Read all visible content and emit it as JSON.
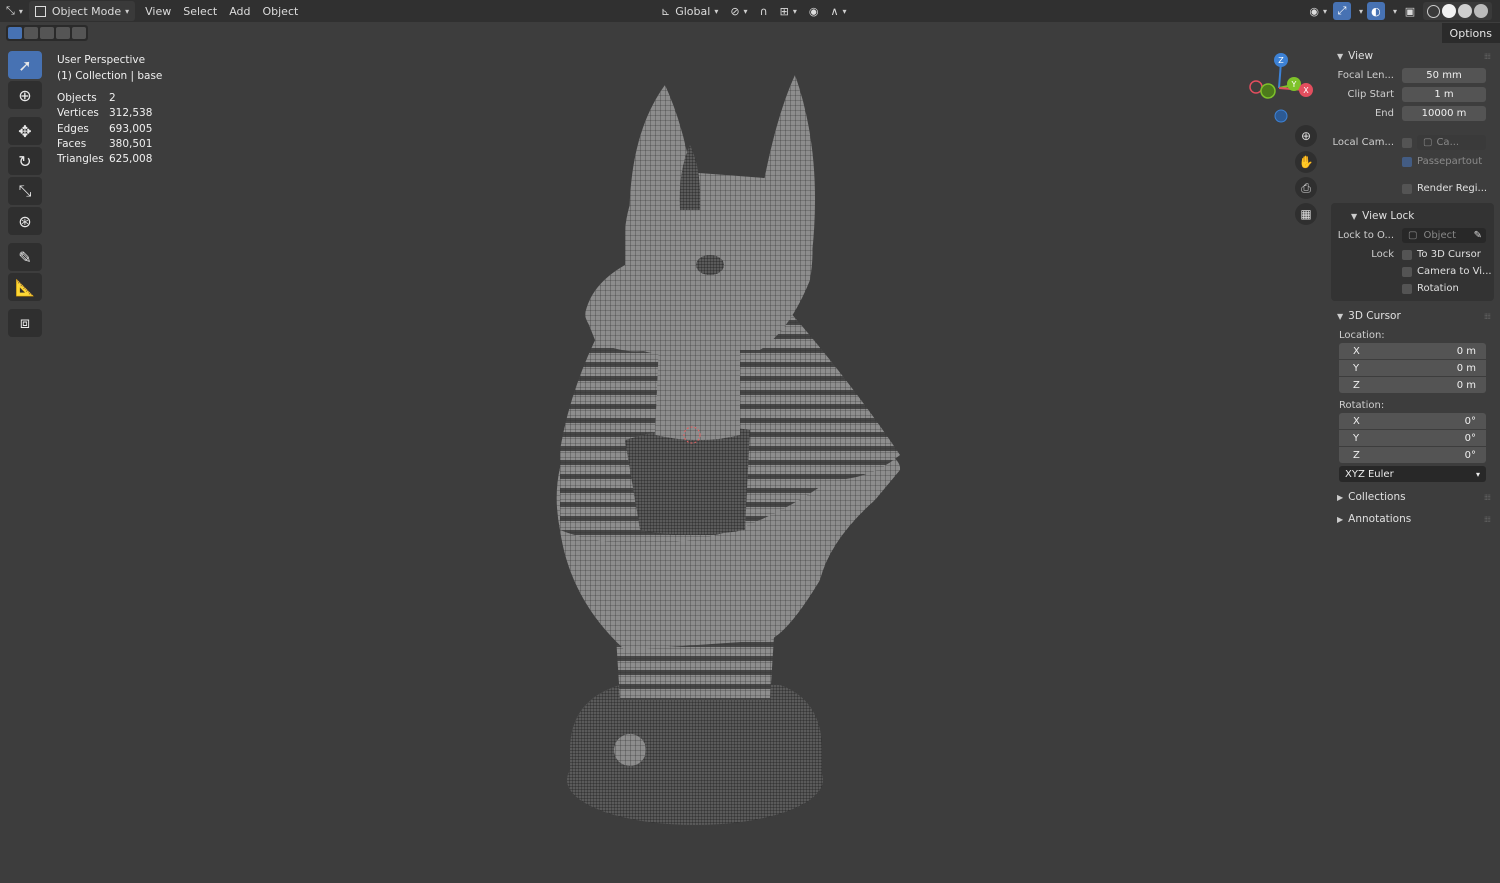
{
  "header": {
    "mode_label": "Object Mode",
    "menus": [
      "View",
      "Select",
      "Add",
      "Object"
    ],
    "orientation_label": "Global",
    "options_label": "Options"
  },
  "overlay": {
    "perspective": "User Perspective",
    "collection": "(1) Collection | base",
    "stats": [
      {
        "label": "Objects",
        "value": "2"
      },
      {
        "label": "Vertices",
        "value": "312,538"
      },
      {
        "label": "Edges",
        "value": "693,005"
      },
      {
        "label": "Faces",
        "value": "380,501"
      },
      {
        "label": "Triangles",
        "value": "625,008"
      }
    ]
  },
  "gizmo": {
    "x": "X",
    "y": "Y",
    "z": "Z",
    "x_color": "#e34e5e",
    "y_color": "#7ec22a",
    "z_color": "#3d82d6"
  },
  "sidebar": {
    "view": {
      "title": "View",
      "focal_label": "Focal Len...",
      "focal_value": "50 mm",
      "clip_start_label": "Clip Start",
      "clip_start_value": "1 m",
      "end_label": "End",
      "end_value": "10000 m",
      "local_cam_label": "Local Cam...",
      "local_cam_value": "Ca...",
      "passepartout_label": "Passepartout",
      "render_region_label": "Render Regi..."
    },
    "view_lock": {
      "title": "View Lock",
      "lock_to_label": "Lock to O...",
      "lock_to_placeholder": "Object",
      "lock_label": "Lock",
      "to_cursor_label": "To 3D Cursor",
      "camera_label": "Camera to Vi...",
      "rotation_label": "Rotation"
    },
    "cursor": {
      "title": "3D Cursor",
      "location_label": "Location:",
      "loc": [
        {
          "axis": "X",
          "value": "0 m"
        },
        {
          "axis": "Y",
          "value": "0 m"
        },
        {
          "axis": "Z",
          "value": "0 m"
        }
      ],
      "rotation_label": "Rotation:",
      "rot": [
        {
          "axis": "X",
          "value": "0°"
        },
        {
          "axis": "Y",
          "value": "0°"
        },
        {
          "axis": "Z",
          "value": "0°"
        }
      ],
      "rotation_mode": "XYZ Euler"
    },
    "collections_title": "Collections",
    "annotations_title": "Annotations"
  },
  "colors": {
    "accent": "#4772b3",
    "background": "#3d3d3d"
  }
}
